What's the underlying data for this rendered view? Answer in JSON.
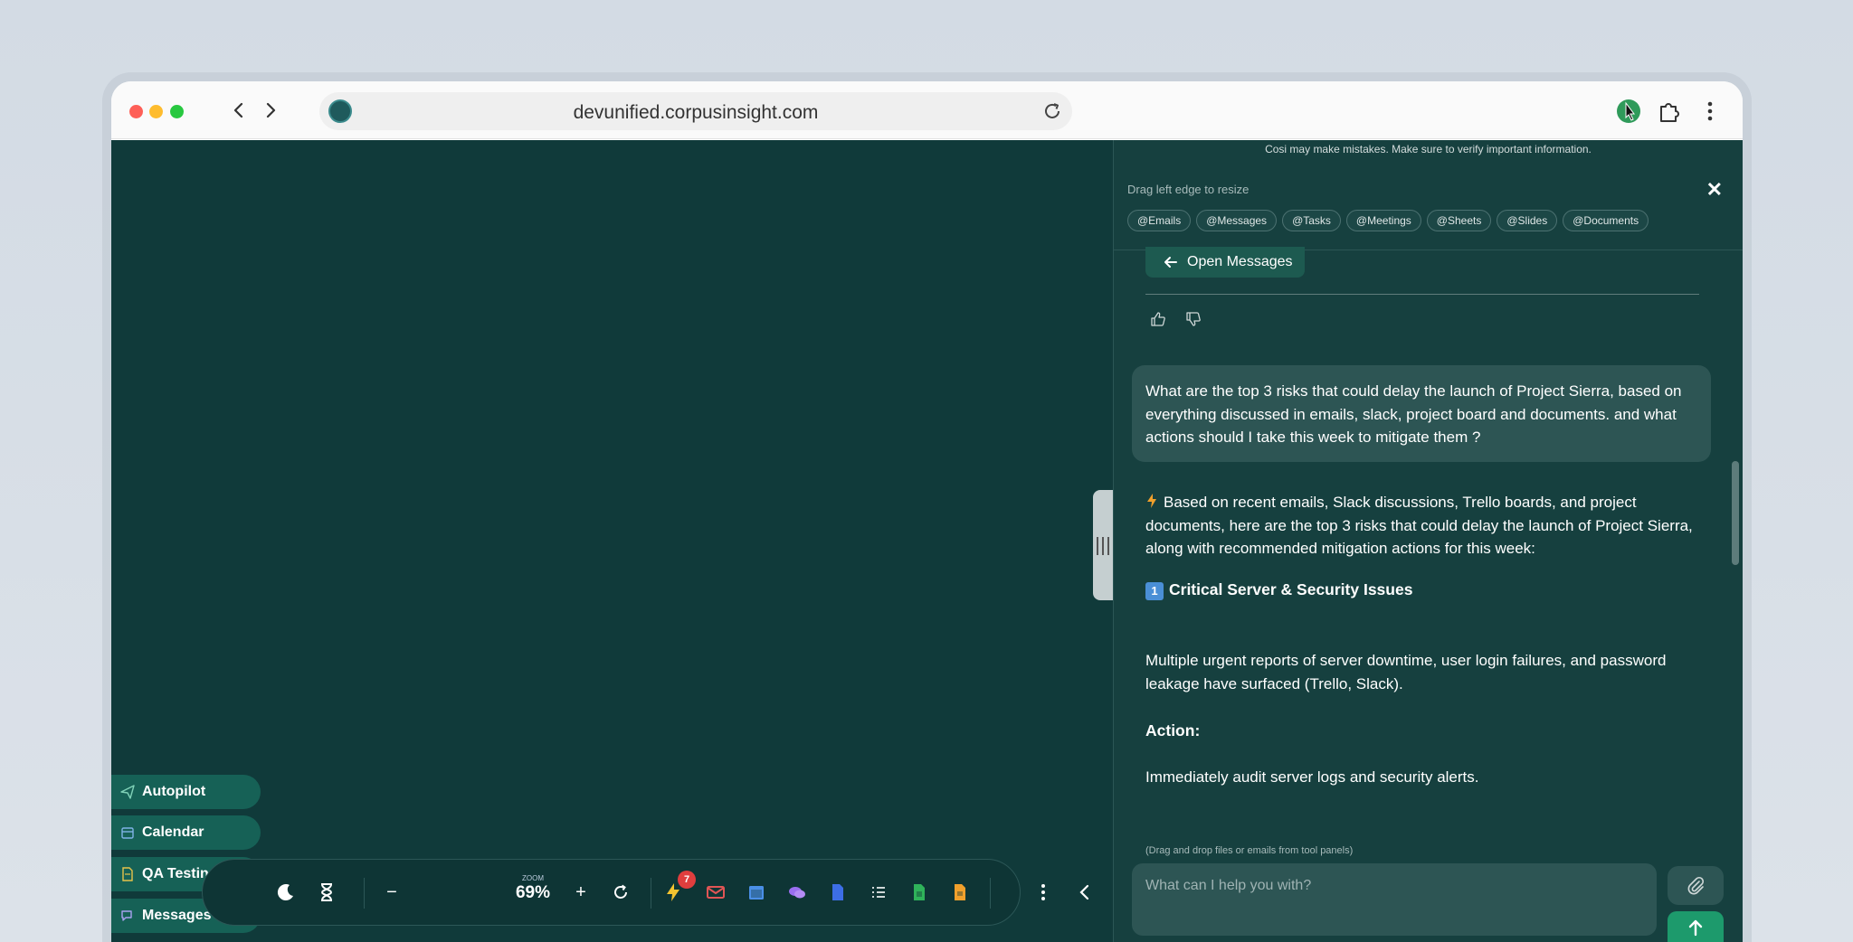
{
  "browser": {
    "url": "devunified.corpusinsight.com"
  },
  "sidebar": {
    "items": [
      {
        "label": "Autopilot",
        "icon": "send-icon"
      },
      {
        "label": "Calendar",
        "icon": "calendar-icon"
      },
      {
        "label": "QA Testin...",
        "icon": "document-icon"
      },
      {
        "label": "Messages",
        "icon": "chat-icon"
      }
    ]
  },
  "toolbar": {
    "zoom_label": "ZOOM",
    "zoom_value": "69%",
    "notification_count": "7"
  },
  "panel": {
    "disclaimer": "Cosi may make mistakes. Make sure to verify important information.",
    "drag_hint": "Drag left edge to resize",
    "chips": [
      "@Emails",
      "@Messages",
      "@Tasks",
      "@Meetings",
      "@Sheets",
      "@Slides",
      "@Documents"
    ],
    "open_messages_label": "Open Messages",
    "user_question": "What are the top 3 risks that could delay the launch of Project Sierra, based on everything discussed in emails, slack, project board and documents. and what actions should I take this week to mitigate them ?",
    "answer_intro": "Based on recent emails, Slack discussions, Trello boards, and project documents, here are the top 3 risks that could delay the launch of Project Sierra, along with recommended mitigation actions for this week:",
    "risk1_number": "1",
    "risk1_title": "Critical Server & Security Issues",
    "risk1_desc": "Multiple urgent reports of server downtime, user login failures, and password leakage have surfaced (Trello, Slack).",
    "action_label": "Action:",
    "action_text": "Immediately audit server logs and security alerts.",
    "drag_drop_hint": "(Drag and drop files or emails from tool panels)",
    "input_placeholder": "What can I help you with?"
  },
  "colors": {
    "workspace_bg": "#103a3a",
    "panel_bg": "#16403f",
    "accent_green": "#1d9a6c",
    "badge_red": "#e03e3e"
  }
}
